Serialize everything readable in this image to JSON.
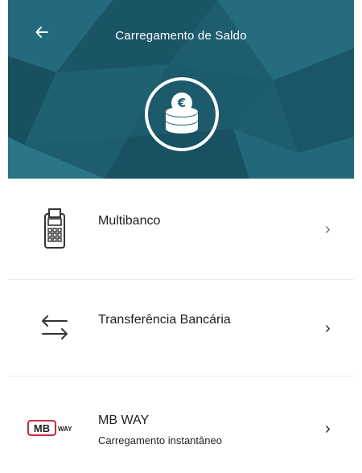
{
  "header": {
    "title": "Carregamento de Saldo",
    "back_icon": "arrow-left-icon",
    "badge_icon": "euro-coins-icon",
    "background_color": "#1e5d6e"
  },
  "options": [
    {
      "title": "Multibanco",
      "icon": "atm-terminal-icon",
      "chevron": "›"
    },
    {
      "title": "Transferência Bancária",
      "icon": "transfer-arrows-icon",
      "chevron": "›"
    },
    {
      "title": "MB WAY",
      "subtitle": "Carregamento instantâneo",
      "icon": "mbway-logo-icon",
      "logo_text": "MB WAY",
      "logo_color": "#c8102e",
      "chevron": "›"
    }
  ]
}
